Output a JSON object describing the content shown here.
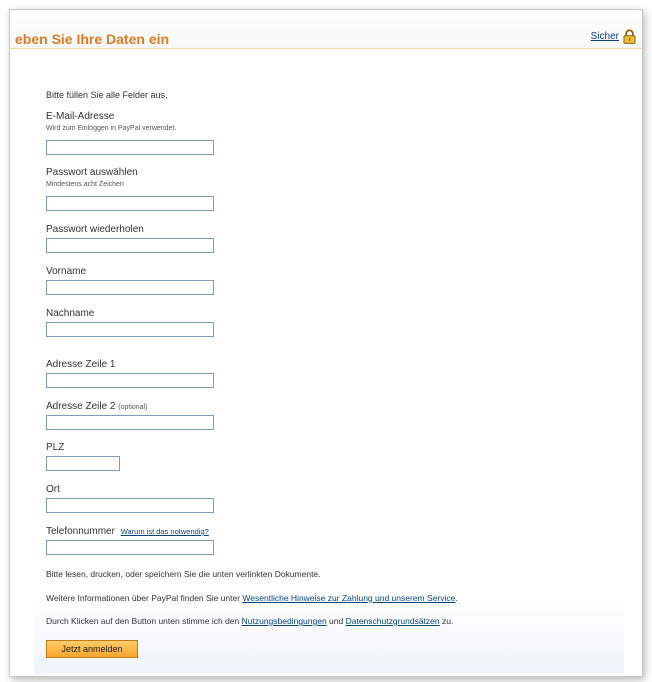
{
  "header": {
    "title": "eben Sie Ihre Daten ein",
    "secure_label": "Sicher"
  },
  "form": {
    "intro": "Bitte füllen Sie alle Felder aus.",
    "email_label": "E-Mail-Adresse",
    "email_hint": "Wird zum Einloggen in PayPal verwendet.",
    "password_label": "Passwort auswählen",
    "password_hint": "Mindestens acht Zeichen",
    "password_repeat_label": "Passwort wiederholen",
    "firstname_label": "Vorname",
    "lastname_label": "Nachname",
    "address1_label": "Adresse Zeile 1",
    "address2_label": "Adresse Zeile 2",
    "address2_optional": "(optional)",
    "zip_label": "PLZ",
    "city_label": "Ort",
    "phone_label": "Telefonnummer",
    "phone_help_link": "Warum ist das notwendig?"
  },
  "info": {
    "line1": "Bitte lesen, drucken, oder speichern Sie die unten verlinkten Dokumente.",
    "line2_text": "Weitere Informationen über PayPal finden Sie unter ",
    "line2_link": "Wesentliche Hinweise zur Zahlung und unserem Service",
    "line2_end": ".",
    "line3_text": "Durch Klicken auf den Button unten stimme ich den ",
    "line3_link1": "Nutzungsbedingungen",
    "line3_mid": " und ",
    "line3_link2": "Datenschutzgrundsätzen",
    "line3_end": " zu."
  },
  "submit_label": "Jetzt anmelden",
  "colors": {
    "title": "#e07b24",
    "link": "#084482",
    "button": "#f6a52c"
  },
  "icons": {
    "secure": "lock-icon"
  }
}
